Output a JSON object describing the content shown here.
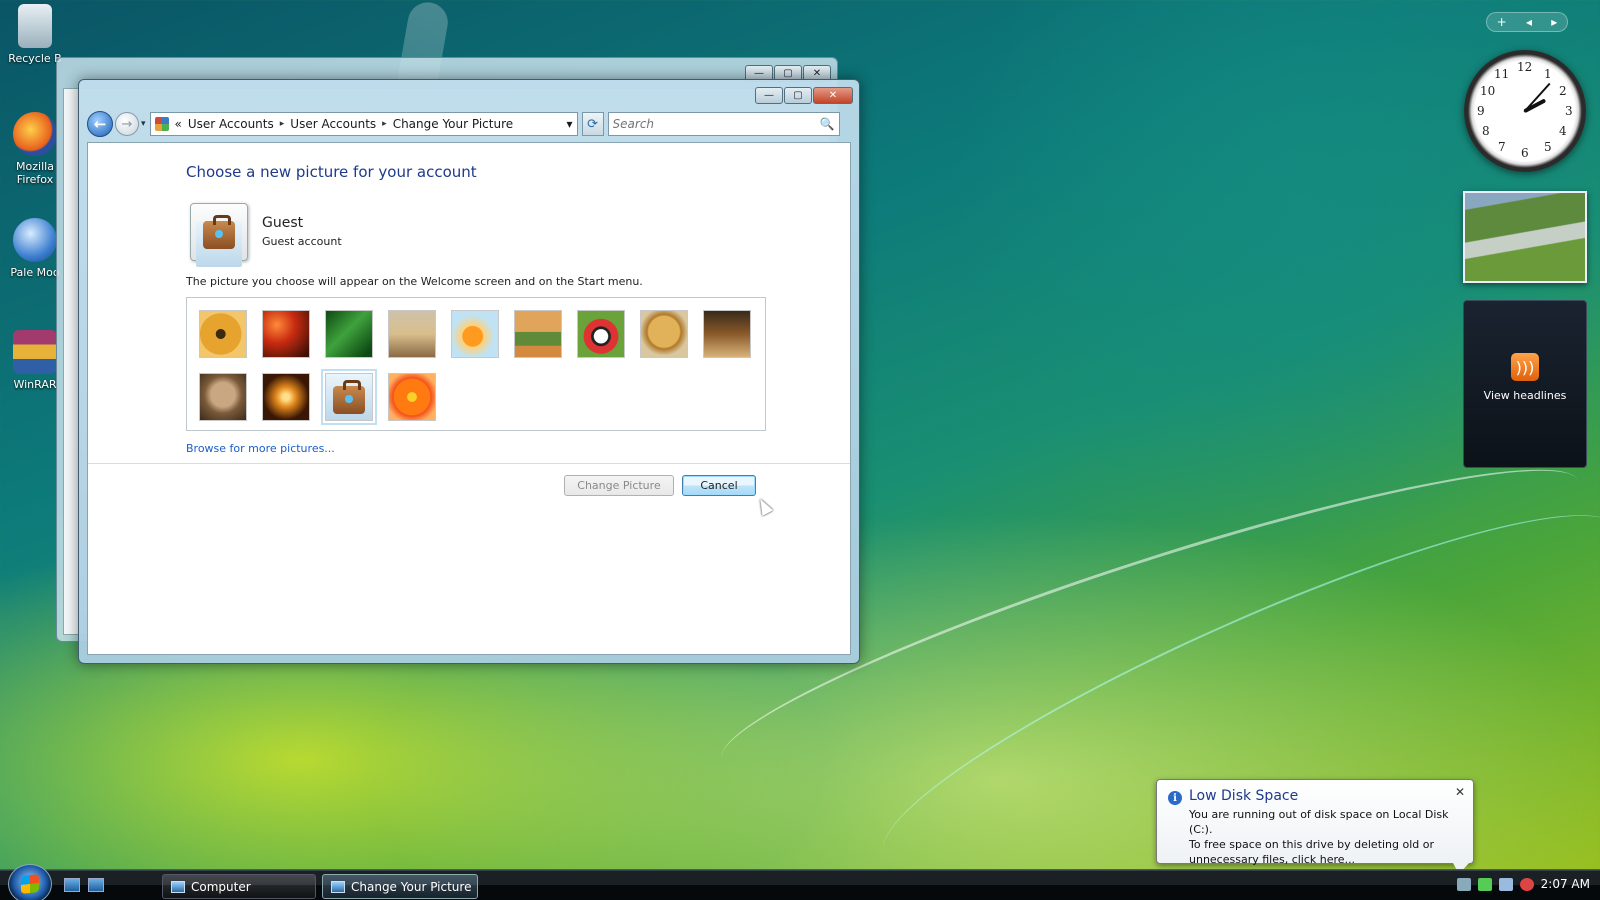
{
  "desktop": {
    "icons": [
      {
        "label": "Recycle B"
      },
      {
        "label": "Mozilla Firefox"
      },
      {
        "label": "Pale Moo"
      },
      {
        "label": "WinRAR"
      }
    ]
  },
  "window": {
    "caption": {
      "minimize": "—",
      "maximize": "▢",
      "close": "✕"
    },
    "nav": {
      "back": "←",
      "forward": "→",
      "dropdown": "▾",
      "refresh": "⟳"
    },
    "breadcrumb": {
      "overflow": "«",
      "items": [
        "User Accounts",
        "User Accounts",
        "Change Your Picture"
      ],
      "separator": "▸",
      "dropdown": "▾"
    },
    "search": {
      "placeholder": "Search",
      "icon": "🔍"
    },
    "content": {
      "title": "Choose a new picture for your account",
      "account_name": "Guest",
      "account_type": "Guest account",
      "description": "The picture you choose will appear on the Welcome screen and on the Start menu.",
      "pictures": [
        {
          "name": "bass-clef"
        },
        {
          "name": "fall-leaves"
        },
        {
          "name": "green-leaf"
        },
        {
          "name": "robot"
        },
        {
          "name": "goldfish"
        },
        {
          "name": "lizard"
        },
        {
          "name": "soccer-ball"
        },
        {
          "name": "dog"
        },
        {
          "name": "chess"
        },
        {
          "name": "kitten"
        },
        {
          "name": "sparkles"
        },
        {
          "name": "guest-suitcase",
          "selected": true
        },
        {
          "name": "orange-flower"
        }
      ],
      "browse_link": "Browse for more pictures...",
      "change_button": "Change Picture",
      "cancel_button": "Cancel"
    }
  },
  "gadgets": {
    "controls": {
      "add": "+",
      "prev": "◂",
      "next": "▸"
    },
    "clock": {
      "numbers": [
        "12",
        "1",
        "2",
        "3",
        "4",
        "5",
        "6",
        "7",
        "8",
        "9",
        "10",
        "11"
      ]
    },
    "feed": {
      "label": "View headlines",
      "icon": ")))"
    }
  },
  "notification": {
    "title": "Low Disk Space",
    "icon": "i",
    "close": "✕",
    "line1": "You are running out of disk space on Local Disk (C:).",
    "line2": "To free space on this drive by deleting old or",
    "line3": "unnecessary files, click here..."
  },
  "taskbar": {
    "items": [
      {
        "label": "Computer"
      },
      {
        "label": "Change Your Picture"
      }
    ],
    "clock": "2:07 AM"
  },
  "colors": {
    "accent_blue": "#1e3a8a",
    "link_blue": "#1a5fc8",
    "close_red": "#c24528"
  }
}
